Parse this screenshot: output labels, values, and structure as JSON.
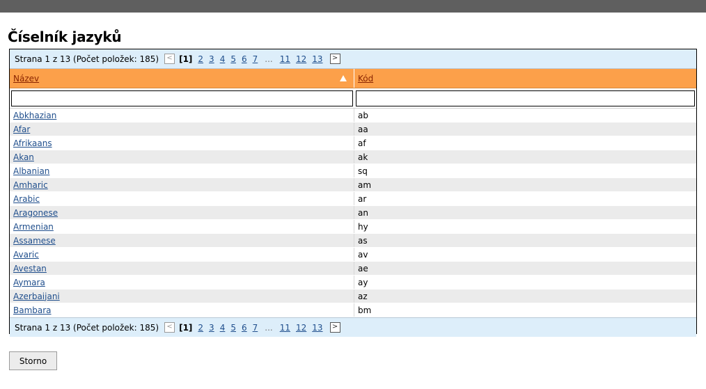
{
  "page": {
    "title": "Číselník jazyků"
  },
  "pager": {
    "summary": "Strana 1 z 13 (Počet položek: 185)",
    "prev_icon": "<",
    "next_icon": ">",
    "current": "[1]",
    "pages": [
      "2",
      "3",
      "4",
      "5",
      "6",
      "7"
    ],
    "ellipsis": "...",
    "last_pages": [
      "11",
      "12",
      "13"
    ]
  },
  "table": {
    "columns": {
      "name": "Název",
      "code": "Kód"
    },
    "sort_icon": "sort-ascending",
    "filter": {
      "name_value": "",
      "code_value": ""
    },
    "rows": [
      {
        "name": "Abkhazian",
        "code": "ab"
      },
      {
        "name": "Afar",
        "code": "aa"
      },
      {
        "name": "Afrikaans",
        "code": "af"
      },
      {
        "name": "Akan",
        "code": "ak"
      },
      {
        "name": "Albanian",
        "code": "sq"
      },
      {
        "name": "Amharic",
        "code": "am"
      },
      {
        "name": "Arabic",
        "code": "ar"
      },
      {
        "name": "Aragonese",
        "code": "an"
      },
      {
        "name": "Armenian",
        "code": "hy"
      },
      {
        "name": "Assamese",
        "code": "as"
      },
      {
        "name": "Avaric",
        "code": "av"
      },
      {
        "name": "Avestan",
        "code": "ae"
      },
      {
        "name": "Aymara",
        "code": "ay"
      },
      {
        "name": "Azerbaijani",
        "code": "az"
      },
      {
        "name": "Bambara",
        "code": "bm"
      }
    ]
  },
  "actions": {
    "cancel_label": "Storno"
  },
  "colors": {
    "header_bg": "#fca04a",
    "pager_bg": "#ddeefa",
    "link": "#1f4e8c",
    "alt_row": "#ebebeb",
    "topbar": "#5f5f5f"
  }
}
